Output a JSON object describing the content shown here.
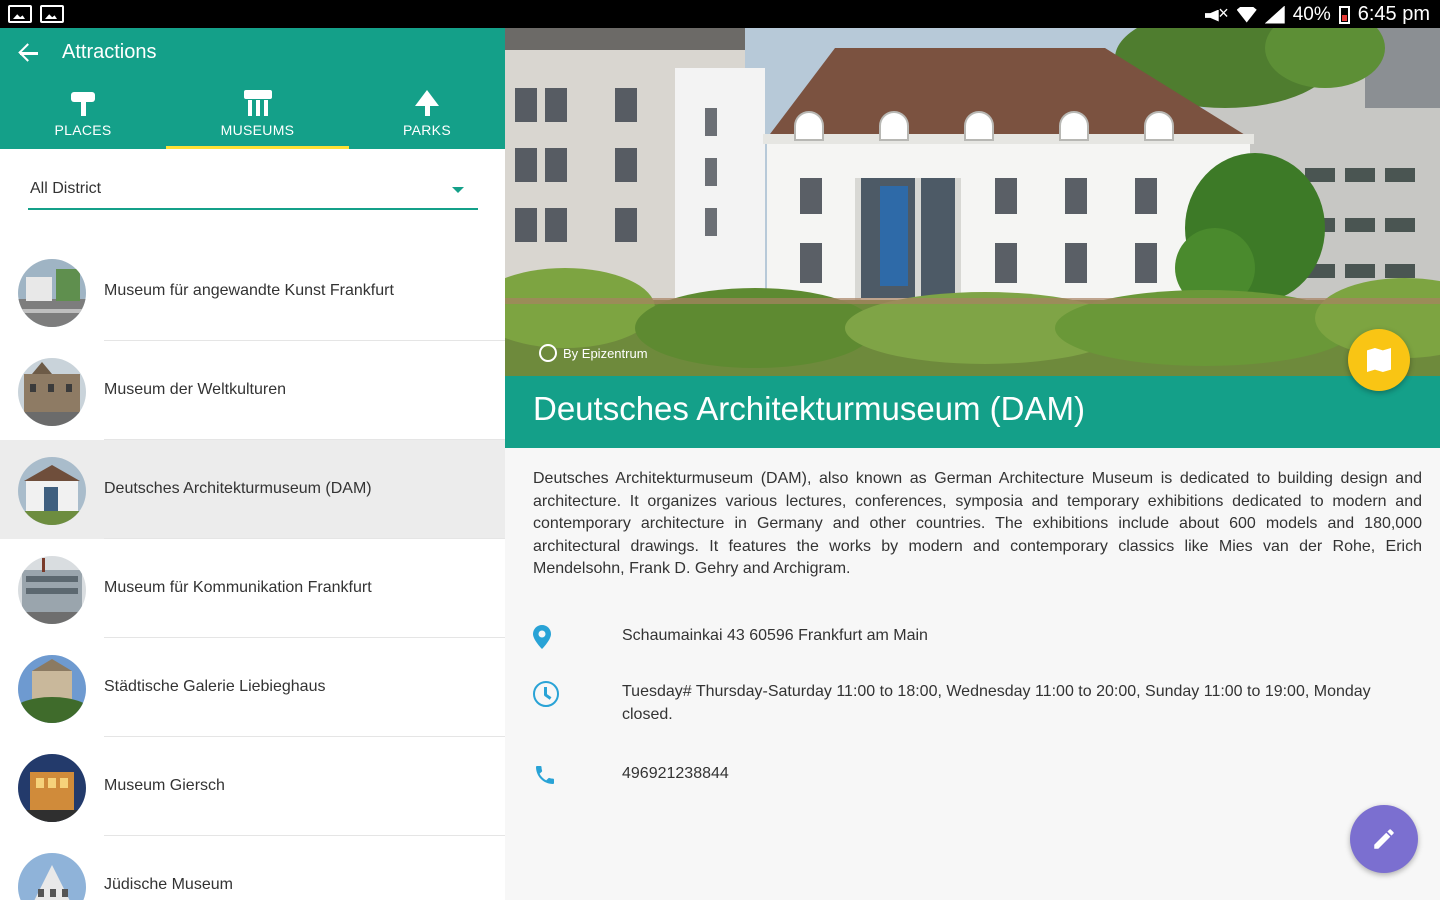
{
  "status_bar": {
    "battery": "40%",
    "time": "6:45 pm"
  },
  "app_bar": {
    "title": "Attractions"
  },
  "tabs": [
    {
      "label": "PLACES",
      "icon": "signpost-icon",
      "active": false
    },
    {
      "label": "MUSEUMS",
      "icon": "museum-icon",
      "active": true
    },
    {
      "label": "PARKS",
      "icon": "tree-icon",
      "active": false
    }
  ],
  "filter": {
    "district_value": "All District"
  },
  "museums": [
    {
      "name": "Museum für angewandte Kunst Frankfurt",
      "selected": false
    },
    {
      "name": "Museum der Weltkulturen",
      "selected": false
    },
    {
      "name": "Deutsches Architekturmuseum (DAM)",
      "selected": true
    },
    {
      "name": "Museum für Kommunikation Frankfurt",
      "selected": false
    },
    {
      "name": "Städtische Galerie Liebieghaus",
      "selected": false
    },
    {
      "name": "Museum Giersch",
      "selected": false
    },
    {
      "name": "Jüdische Museum",
      "selected": false
    }
  ],
  "detail": {
    "image_credit": "By Epizentrum",
    "title": "Deutsches Architekturmuseum (DAM)",
    "description": "Deutsches Architekturmuseum (DAM), also known as German Architecture Museum is dedicated to building design and architecture. It organizes various lectures, conferences, symposia and temporary exhibitions dedicated to modern and contemporary architecture in Germany and other countries. The exhibitions include about 600 models and 180,000 architectural drawings. It features the works by modern and contemporary classics like Mies van der Rohe, Erich Mendelsohn, Frank D. Gehry and Archigram.",
    "address": "Schaumainkai 43 60596 Frankfurt am Main",
    "hours": "Tuesday# Thursday-Saturday 11:00 to 18:00, Wednesday 11:00 to 20:00, Sunday 11:00 to 19:00, Monday closed.",
    "phone": "496921238844"
  },
  "colors": {
    "primary": "#14a089",
    "accent_tab": "#ffe135",
    "map_fab": "#f9c514",
    "edit_fab": "#7b6fd0",
    "info_icon": "#29a3d6"
  }
}
